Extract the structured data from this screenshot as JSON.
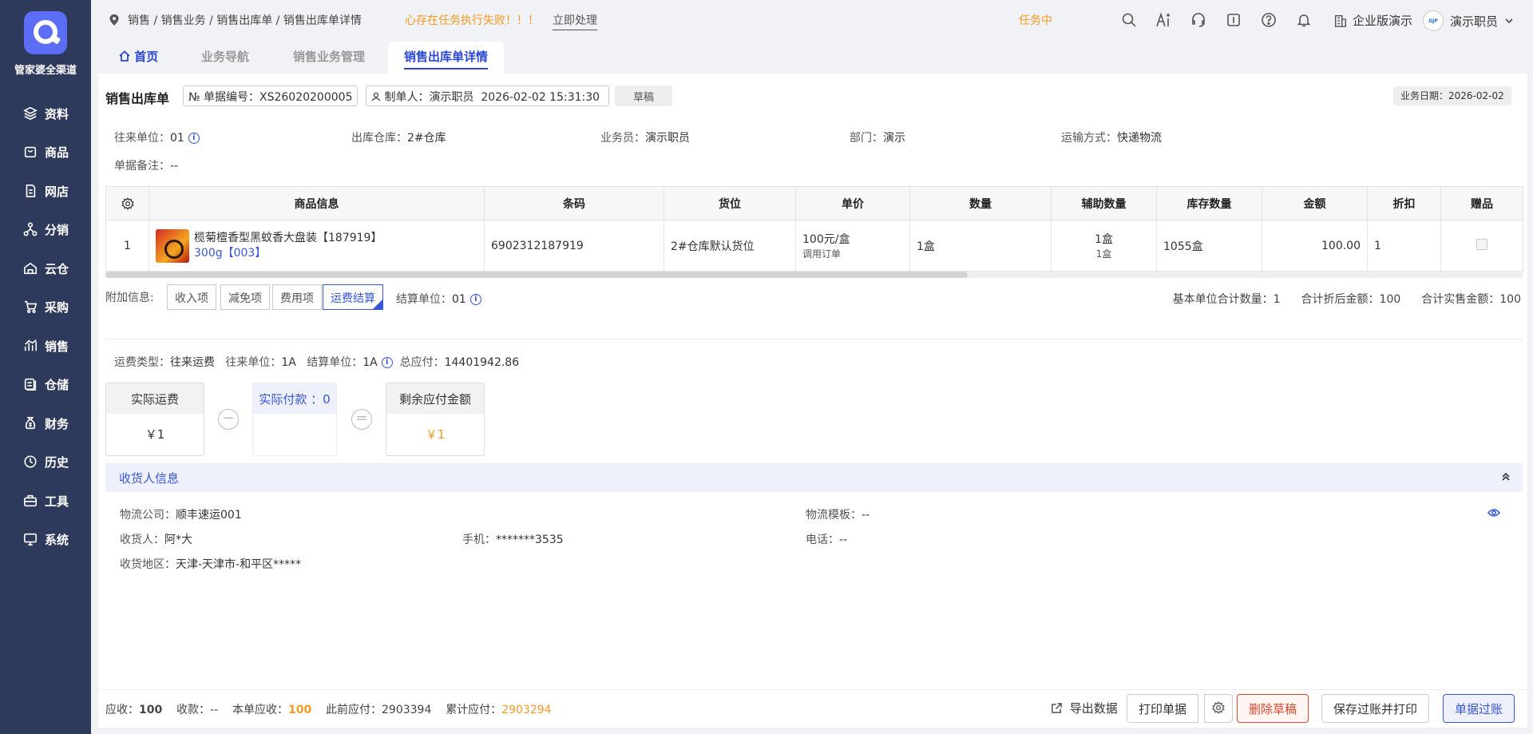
{
  "sidebar": {
    "brand": "管家婆全渠道",
    "items": [
      {
        "label": "资料",
        "icon": "layers-icon"
      },
      {
        "label": "商品",
        "icon": "shop-bag-icon"
      },
      {
        "label": "网店",
        "icon": "document-icon"
      },
      {
        "label": "分销",
        "icon": "network-icon"
      },
      {
        "label": "云仓",
        "icon": "cloud-warehouse-icon"
      },
      {
        "label": "采购",
        "icon": "cart-icon"
      },
      {
        "label": "销售",
        "icon": "sales-chart-icon"
      },
      {
        "label": "仓储",
        "icon": "storage-icon"
      },
      {
        "label": "财务",
        "icon": "finance-icon"
      },
      {
        "label": "历史",
        "icon": "history-icon"
      },
      {
        "label": "工具",
        "icon": "toolbox-icon"
      },
      {
        "label": "系统",
        "icon": "monitor-icon"
      }
    ]
  },
  "header": {
    "breadcrumb": "销售 / 销售业务 / 销售出库单 / 销售出库单详情",
    "warning": "心存在任务执行失败！！！",
    "handle_link": "立即处理",
    "task_status": "任务中",
    "edition": "企业版演示",
    "user": "演示职员"
  },
  "tabs": [
    "首页",
    "业务导航",
    "销售业务管理",
    "销售出库单详情"
  ],
  "doc": {
    "title": "销售出库单",
    "number_label": "№ 单据编号：",
    "number": "XS26020200005",
    "maker_label": "制单人：",
    "maker": "演示职员",
    "made_time": "2026-02-02 15:31:30",
    "status": "草稿",
    "biz_date": "业务日期：2026-02-02"
  },
  "fields": {
    "partner_label": "往来单位：",
    "partner": "01",
    "warehouse_label": "出库仓库：",
    "warehouse": "2#仓库",
    "salesman_label": "业务员：",
    "salesman": "演示职员",
    "dept_label": "部门：",
    "dept": "演示",
    "transport_label": "运输方式：",
    "transport": "快递物流",
    "remark_label": "单据备注：",
    "remark": "--"
  },
  "table": {
    "headers": [
      "商品信息",
      "条码",
      "货位",
      "单价",
      "数量",
      "辅助数量",
      "库存数量",
      "金额",
      "折扣",
      "赠品"
    ],
    "row": {
      "index": "1",
      "name": "榄菊檀香型黑蚊香大盘装【187919】",
      "spec": "300g【003】",
      "barcode": "6902312187919",
      "location": "2#仓库默认货位",
      "price": "100元/盒",
      "price_note": "调用订单",
      "qty": "1盒",
      "aux_qty": "1盒",
      "aux_qty2": "1盒",
      "stock": "1055盒",
      "amount": "100.00",
      "discount": "1"
    }
  },
  "attach": {
    "label": "附加信息:",
    "tabs": [
      "收入项",
      "减免项",
      "费用项",
      "运费结算"
    ],
    "settle_label": "结算单位：",
    "settle": "01",
    "sum_base": "基本单位合计数量：1",
    "sum_after": "合计折后金额：100",
    "sum_sale": "合计实售金额：100"
  },
  "freight": {
    "type_label": "运费类型：",
    "type": "往来运费",
    "partner_label": "往来单位：",
    "partner": "1A",
    "settle_label": "结算单位：",
    "settle": "1A",
    "total_label": "总应付：",
    "total": "14401942.86",
    "card1_title": "实际运费",
    "card1_value": "￥1",
    "card2_title": "实际付款 ：0",
    "card3_title": "剩余应付金额",
    "card3_value": "￥1",
    "minus": "−",
    "equals": "="
  },
  "consignee": {
    "title": "收货人信息",
    "logistics_label": "物流公司：",
    "logistics": "顺丰速运001",
    "template_label": "物流模板：",
    "template": "--",
    "receiver_label": "收货人：",
    "receiver": "阿*大",
    "mobile_label": "手机：",
    "mobile": "*******3535",
    "phone_label": "电话：",
    "phone": "--",
    "region_label": "收货地区：",
    "region": "天津-天津市-和平区*****"
  },
  "footer": {
    "receivable_label": "应收：",
    "receivable": "100",
    "received_label": "收款：",
    "received": "--",
    "this_label": "本单应收：",
    "this": "100",
    "prev_label": "此前应付：",
    "prev": "2903394",
    "accum_label": "累计应付：",
    "accum": "2903294",
    "export": "导出数据",
    "print": "打印单据",
    "delete": "删除草稿",
    "save_print": "保存过账并打印",
    "post": "单据过账"
  },
  "colors": {
    "accent": "#3856d6",
    "warning": "#f59a23",
    "sidebar": "#2e3a5c",
    "danger": "#e0452c"
  }
}
